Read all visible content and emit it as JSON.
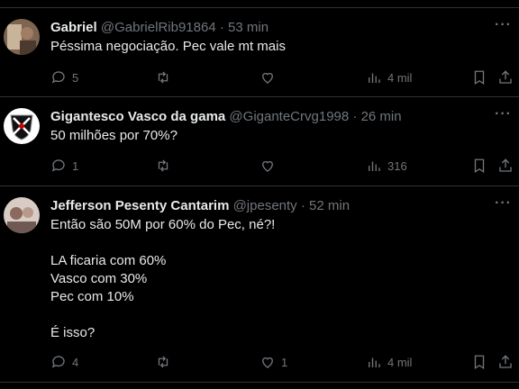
{
  "tweets": [
    {
      "name": "Gabriel",
      "handle": "@GabrielRib91864",
      "dot": "·",
      "time": "53 min",
      "lines": [
        "Péssima negociação. Pec vale mt mais"
      ],
      "replies": "5",
      "retweets": "",
      "likes": "",
      "views": "4 mil",
      "avatar_colors": [
        "#6b4e3a",
        "#b59a7a"
      ]
    },
    {
      "name": "Gigantesco Vasco da gama",
      "handle": "@GiganteCrvg1998",
      "dot": "·",
      "time": "26 min",
      "lines": [
        "50 milhões por 70%?"
      ],
      "replies": "1",
      "retweets": "",
      "likes": "",
      "views": "316",
      "avatar_colors": [
        "#ffffff",
        "#111111"
      ]
    },
    {
      "name": "Jefferson Pesenty Cantarim",
      "handle": "@jpesenty",
      "dot": "·",
      "time": "52 min",
      "lines": [
        "Então são 50M por 60% do Pec, né?!",
        "",
        "LA ficaria com 60%",
        "Vasco com 30%",
        "Pec com 10%",
        "",
        "É isso?"
      ],
      "replies": "4",
      "retweets": "",
      "likes": "1",
      "views": "4 mil",
      "avatar_colors": [
        "#c9b9b0",
        "#7a5f58"
      ]
    }
  ],
  "more_symbol": "···"
}
